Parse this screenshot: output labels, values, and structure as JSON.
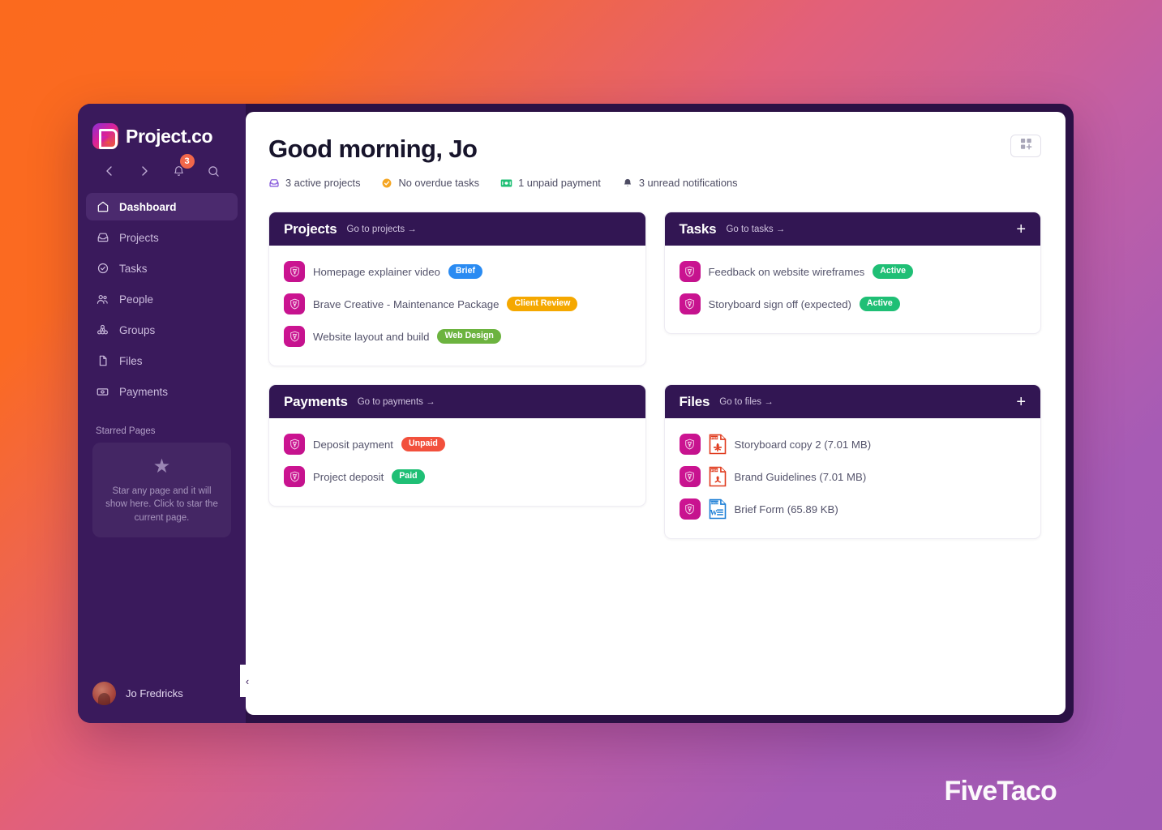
{
  "brand": {
    "logo_text": "Project.co",
    "logo_icon": "project-co-logo-icon"
  },
  "sidebar": {
    "nav_controls": [
      {
        "name": "back-arrow-icon",
        "label": "Back"
      },
      {
        "name": "forward-arrow-icon",
        "label": "Forward"
      },
      {
        "name": "bell-icon",
        "label": "Notifications",
        "badge": "3"
      },
      {
        "name": "search-icon",
        "label": "Search"
      }
    ],
    "items": [
      {
        "label": "Dashboard",
        "icon": "home-icon",
        "active": true
      },
      {
        "label": "Projects",
        "icon": "inbox-icon",
        "active": false
      },
      {
        "label": "Tasks",
        "icon": "check-circle-icon",
        "active": false
      },
      {
        "label": "People",
        "icon": "people-icon",
        "active": false
      },
      {
        "label": "Groups",
        "icon": "groups-icon",
        "active": false
      },
      {
        "label": "Files",
        "icon": "file-icon",
        "active": false
      },
      {
        "label": "Payments",
        "icon": "payments-icon",
        "active": false
      }
    ],
    "starred": {
      "section_label": "Starred Pages",
      "star_icon": "star-icon",
      "empty_text": "Star any page and it will show here. Click to star the current page."
    },
    "user": {
      "name": "Jo Fredricks",
      "avatar": "user-avatar"
    },
    "collapse_label": "‹"
  },
  "header": {
    "greeting": "Good morning, Jo",
    "widget_button": {
      "name": "add-widget-button",
      "icon": "grid-plus-icon"
    },
    "status": [
      {
        "icon": "projects-icon",
        "color": "#7b4bd8",
        "text": "3 active projects"
      },
      {
        "icon": "check-circle-icon",
        "color": "#f5a623",
        "text": "No overdue tasks"
      },
      {
        "icon": "money-icon",
        "color": "#1fbf75",
        "text": "1 unpaid payment"
      },
      {
        "icon": "bell-icon",
        "color": "#4d4c63",
        "text": "3 unread notifications"
      }
    ]
  },
  "cards": {
    "projects": {
      "title": "Projects",
      "link": "Go to projects  →",
      "has_plus": false,
      "rows": [
        {
          "icon": "project-badge-icon",
          "label": "Homepage explainer video",
          "pill": "Brief",
          "pill_color": "#2a8bf2"
        },
        {
          "icon": "project-badge-icon",
          "label": "Brave Creative - Maintenance Package",
          "pill": "Client Review",
          "pill_color": "#f5a800"
        },
        {
          "icon": "project-badge-icon",
          "label": "Website layout and build",
          "pill": "Web Design",
          "pill_color": "#6cb33f"
        }
      ]
    },
    "tasks": {
      "title": "Tasks",
      "link": "Go to tasks  →",
      "plus": "+",
      "rows": [
        {
          "icon": "project-badge-icon",
          "label": "Feedback on website wireframes",
          "pill": "Active",
          "pill_color": "#1fbf75"
        },
        {
          "icon": "project-badge-icon",
          "label": "Storyboard sign off (expected)",
          "pill": "Active",
          "pill_color": "#1fbf75"
        }
      ]
    },
    "payments": {
      "title": "Payments",
      "link": "Go to payments  →",
      "has_plus": false,
      "rows": [
        {
          "icon": "project-badge-icon",
          "label": "Deposit payment",
          "pill": "Unpaid",
          "pill_color": "#f2503c"
        },
        {
          "icon": "project-badge-icon",
          "label": "Project deposit",
          "pill": "Paid",
          "pill_color": "#1fbf75"
        }
      ]
    },
    "files": {
      "title": "Files",
      "link": "Go to files  →",
      "plus": "+",
      "rows": [
        {
          "icon": "project-badge-icon",
          "file_type": "pdf",
          "file_icon": "pdf-file-icon",
          "label": "Storyboard copy 2 (7.01 MB)"
        },
        {
          "icon": "project-badge-icon",
          "file_type": "pdf",
          "file_icon": "pdf-file-icon",
          "label": "Brand Guidelines (7.01 MB)"
        },
        {
          "icon": "project-badge-icon",
          "file_type": "docx",
          "file_icon": "word-file-icon",
          "label": "Brief Form (65.89 KB)"
        }
      ]
    }
  },
  "watermark": "FiveTaco",
  "colors": {
    "sidebar_bg": "#3a1a5c",
    "window_bg": "#2b1145",
    "card_header": "#321653",
    "accent_magenta": "#cf1493",
    "bg_gradient_from": "#fb6a1e",
    "bg_gradient_to": "#a25ab4"
  }
}
